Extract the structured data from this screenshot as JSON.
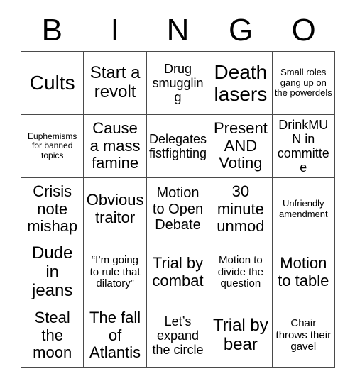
{
  "card": {
    "title_letters": [
      "B",
      "I",
      "N",
      "G",
      "O"
    ],
    "columns": 5,
    "rows": 5,
    "free_space": false,
    "border_color": "#4a4a4a",
    "text_color": "#000000",
    "background_color": "#ffffff",
    "cells": [
      {
        "text": "Cults",
        "size": "fs-28"
      },
      {
        "text": "Start a revolt",
        "size": "fs-24"
      },
      {
        "text": "Drug smuggling",
        "size": "fs-18"
      },
      {
        "text": "Death lasers",
        "size": "fs-28"
      },
      {
        "text": "Small roles gang up on the powerdels",
        "size": "fs-13"
      },
      {
        "text": "Euphemisms for banned topics",
        "size": "fs-12"
      },
      {
        "text": "Cause a mass famine",
        "size": "fs-22"
      },
      {
        "text": "Delegates fistfighting",
        "size": "fs-18"
      },
      {
        "text": "Present AND Voting",
        "size": "fs-22"
      },
      {
        "text": "DrinkMUN in committee",
        "size": "fs-18"
      },
      {
        "text": "Crisis note mishap",
        "size": "fs-22"
      },
      {
        "text": "Obvious traitor",
        "size": "fs-22"
      },
      {
        "text": "Motion to Open Debate",
        "size": "fs-20"
      },
      {
        "text": "30 minute unmod",
        "size": "fs-22"
      },
      {
        "text": "Unfriendly amendment",
        "size": "fs-13"
      },
      {
        "text": "Dude in jeans",
        "size": "fs-24"
      },
      {
        "text": "“I’m going to rule that dilatory”",
        "size": "fs-15"
      },
      {
        "text": "Trial by combat",
        "size": "fs-22"
      },
      {
        "text": "Motion to divide the question",
        "size": "fs-15"
      },
      {
        "text": "Motion to table",
        "size": "fs-22"
      },
      {
        "text": "Steal the moon",
        "size": "fs-22"
      },
      {
        "text": "The fall of Atlantis",
        "size": "fs-22"
      },
      {
        "text": "Let’s expand the circle",
        "size": "fs-18"
      },
      {
        "text": "Trial by bear",
        "size": "fs-24"
      },
      {
        "text": "Chair throws their gavel",
        "size": "fs-15"
      }
    ]
  }
}
